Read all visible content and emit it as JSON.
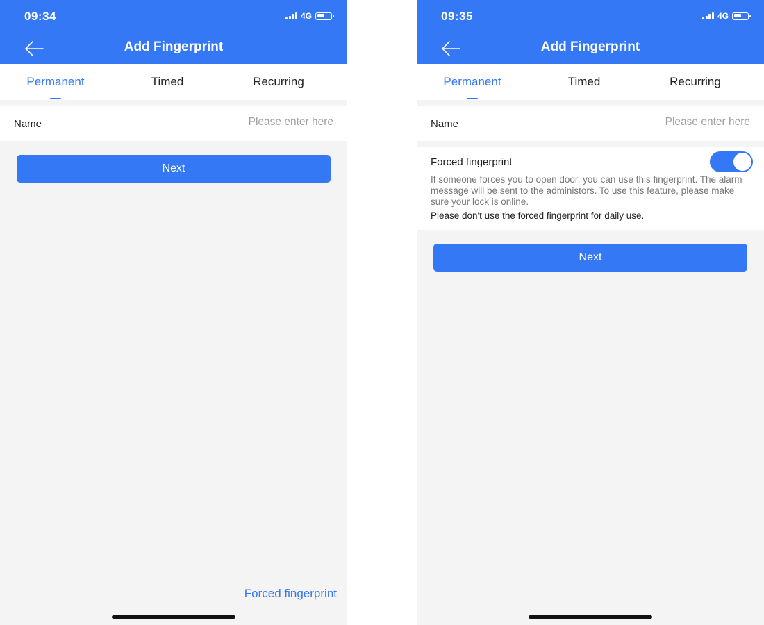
{
  "colors": {
    "accent": "#3478f6",
    "background": "#f4f4f4"
  },
  "screens": [
    {
      "status": {
        "time": "09:34",
        "network": "4G",
        "signal_icon": "cellular-signal-icon",
        "battery_icon": "battery-icon"
      },
      "header": {
        "back_icon": "arrow-left-icon",
        "title": "Add Fingerprint"
      },
      "tabs": [
        {
          "label": "Permanent",
          "active": true
        },
        {
          "label": "Timed",
          "active": false
        },
        {
          "label": "Recurring",
          "active": false
        }
      ],
      "name_field": {
        "label": "Name",
        "value": "",
        "placeholder": "Please enter here"
      },
      "next_label": "Next",
      "forced_link": "Forced fingerprint"
    },
    {
      "status": {
        "time": "09:35",
        "network": "4G",
        "signal_icon": "cellular-signal-icon",
        "battery_icon": "battery-icon"
      },
      "header": {
        "back_icon": "arrow-left-icon",
        "title": "Add Fingerprint"
      },
      "tabs": [
        {
          "label": "Permanent",
          "active": true
        },
        {
          "label": "Timed",
          "active": false
        },
        {
          "label": "Recurring",
          "active": false
        }
      ],
      "name_field": {
        "label": "Name",
        "value": "",
        "placeholder": "Please enter here"
      },
      "forced": {
        "title": "Forced fingerprint",
        "enabled": true,
        "description": "If someone forces you to open door, you can use this fingerprint. The alarm message will be sent to the administors. To use this feature, please make sure your lock is online.",
        "warning": "Please don't use the forced fingerprint for daily use."
      },
      "next_label": "Next"
    }
  ]
}
